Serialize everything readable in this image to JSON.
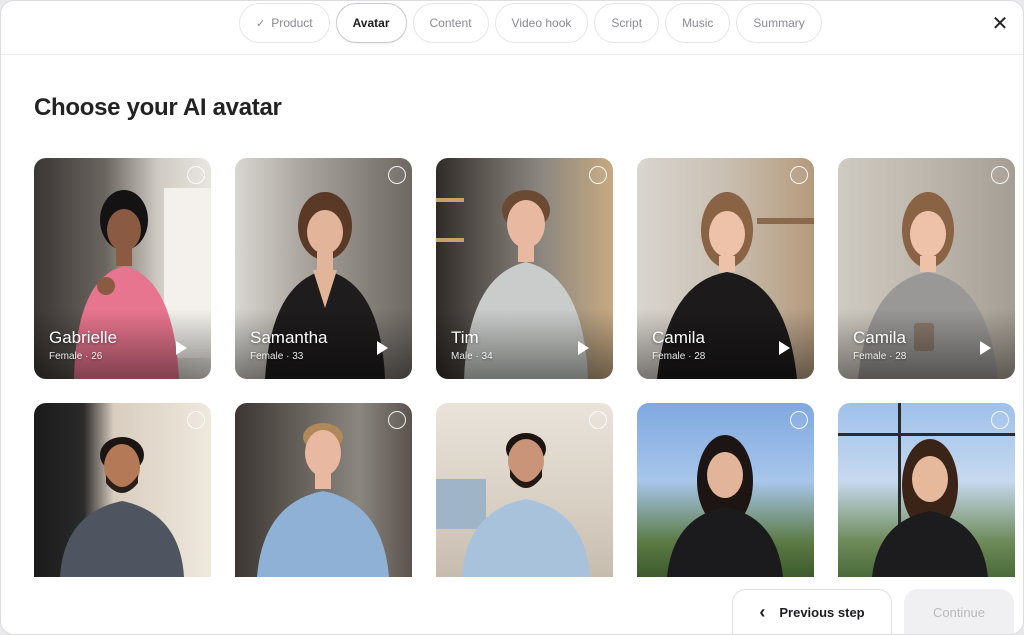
{
  "stepper": {
    "steps": [
      {
        "label": "Product",
        "state": "completed",
        "icon": "check-icon"
      },
      {
        "label": "Avatar",
        "state": "active"
      },
      {
        "label": "Content",
        "state": "upcoming"
      },
      {
        "label": "Video hook",
        "state": "upcoming"
      },
      {
        "label": "Script",
        "state": "upcoming"
      },
      {
        "label": "Music",
        "state": "upcoming"
      },
      {
        "label": "Summary",
        "state": "upcoming"
      }
    ],
    "check_glyph": "✓",
    "close_glyph": "✕"
  },
  "title": "Choose your AI avatar",
  "avatars": [
    {
      "name": "Gabrielle",
      "gender": "Female",
      "age": "26",
      "meta": "Female · 26"
    },
    {
      "name": "Samantha",
      "gender": "Female",
      "age": "33",
      "meta": "Female · 33"
    },
    {
      "name": "Tim",
      "gender": "Male",
      "age": "34",
      "meta": "Male · 34"
    },
    {
      "name": "Camila",
      "gender": "Female",
      "age": "28",
      "meta": "Female · 28"
    },
    {
      "name": "Camila",
      "gender": "Female",
      "age": "28",
      "meta": "Female · 28"
    }
  ],
  "footer": {
    "previous_label": "Previous step",
    "continue_label": "Continue",
    "continue_enabled": false
  },
  "colors": {
    "accent_text": "#1d1d1f",
    "muted_text": "#8a8a92",
    "disabled_bg": "#f0f0f2"
  }
}
